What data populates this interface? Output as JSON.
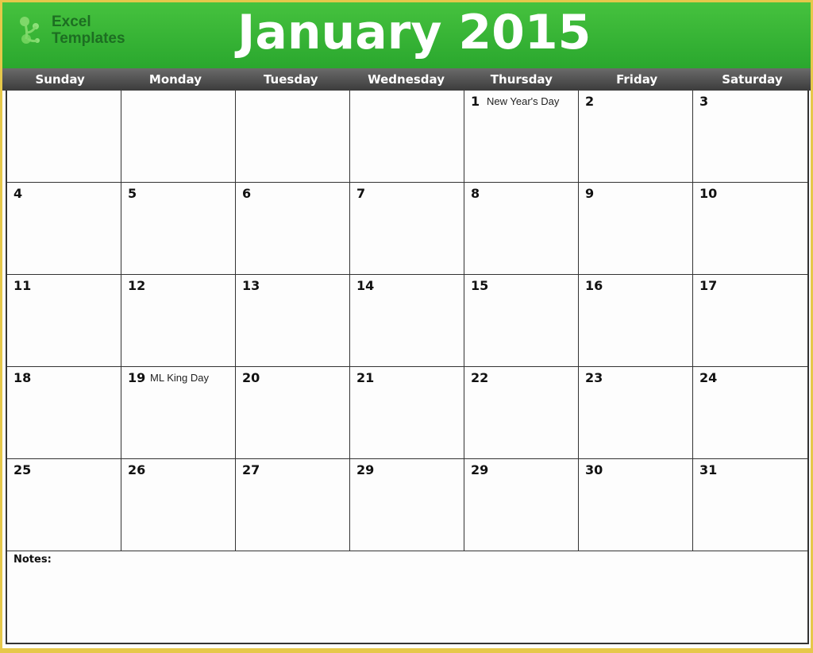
{
  "brand": {
    "line1": "Excel",
    "line2": "Templates"
  },
  "title": "January 2015",
  "colors": {
    "banner": "#3bb739",
    "daybar": "#4f4f4f",
    "frame": "#e6c84a"
  },
  "weekdays": [
    "Sunday",
    "Monday",
    "Tuesday",
    "Wednesday",
    "Thursday",
    "Friday",
    "Saturday"
  ],
  "weeks": [
    [
      {
        "day": ""
      },
      {
        "day": ""
      },
      {
        "day": ""
      },
      {
        "day": ""
      },
      {
        "day": "1",
        "event": "New Year's Day"
      },
      {
        "day": "2"
      },
      {
        "day": "3"
      }
    ],
    [
      {
        "day": "4"
      },
      {
        "day": "5"
      },
      {
        "day": "6"
      },
      {
        "day": "7"
      },
      {
        "day": "8"
      },
      {
        "day": "9"
      },
      {
        "day": "10"
      }
    ],
    [
      {
        "day": "11"
      },
      {
        "day": "12"
      },
      {
        "day": "13"
      },
      {
        "day": "14"
      },
      {
        "day": "15"
      },
      {
        "day": "16"
      },
      {
        "day": "17"
      }
    ],
    [
      {
        "day": "18"
      },
      {
        "day": "19",
        "event": "ML King Day"
      },
      {
        "day": "20"
      },
      {
        "day": "21"
      },
      {
        "day": "22"
      },
      {
        "day": "23"
      },
      {
        "day": "24"
      }
    ],
    [
      {
        "day": "25"
      },
      {
        "day": "26"
      },
      {
        "day": "27"
      },
      {
        "day": "29"
      },
      {
        "day": "29"
      },
      {
        "day": "30"
      },
      {
        "day": "31"
      }
    ]
  ],
  "notes_label": "Notes:"
}
